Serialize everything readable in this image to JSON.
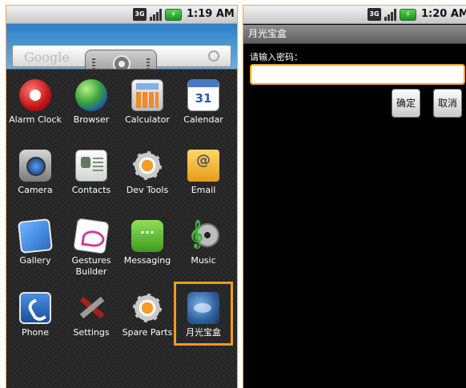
{
  "left_screen": {
    "status": {
      "network": "3G",
      "clock": "1:19 AM"
    },
    "search_widget": {
      "logo": "Google"
    },
    "apps": [
      {
        "label": "Alarm Clock",
        "icon": "alarm-clock-icon"
      },
      {
        "label": "Browser",
        "icon": "globe-icon"
      },
      {
        "label": "Calculator",
        "icon": "calculator-icon"
      },
      {
        "label": "Calendar",
        "icon": "calendar-icon",
        "badge": "31"
      },
      {
        "label": "Camera",
        "icon": "camera-icon"
      },
      {
        "label": "Contacts",
        "icon": "contacts-icon"
      },
      {
        "label": "Dev Tools",
        "icon": "gear-icon"
      },
      {
        "label": "Email",
        "icon": "email-icon"
      },
      {
        "label": "Gallery",
        "icon": "gallery-icon"
      },
      {
        "label": "Gestures Builder",
        "icon": "gestures-icon"
      },
      {
        "label": "Messaging",
        "icon": "messaging-icon"
      },
      {
        "label": "Music",
        "icon": "music-icon"
      },
      {
        "label": "Phone",
        "icon": "phone-icon"
      },
      {
        "label": "Settings",
        "icon": "settings-icon"
      },
      {
        "label": "Spare Parts",
        "icon": "gear-icon"
      },
      {
        "label": "月光宝盒",
        "icon": "moon-box-icon",
        "highlighted": true
      }
    ]
  },
  "right_screen": {
    "status": {
      "network": "3G",
      "clock": "1:20 AM"
    },
    "title": "月光宝盒",
    "prompt": "请输入密码：",
    "password_value": "",
    "ok_label": "确定",
    "cancel_label": "取消"
  },
  "colors": {
    "highlight": "#f39a1c",
    "input_focus": "#f0a527"
  }
}
